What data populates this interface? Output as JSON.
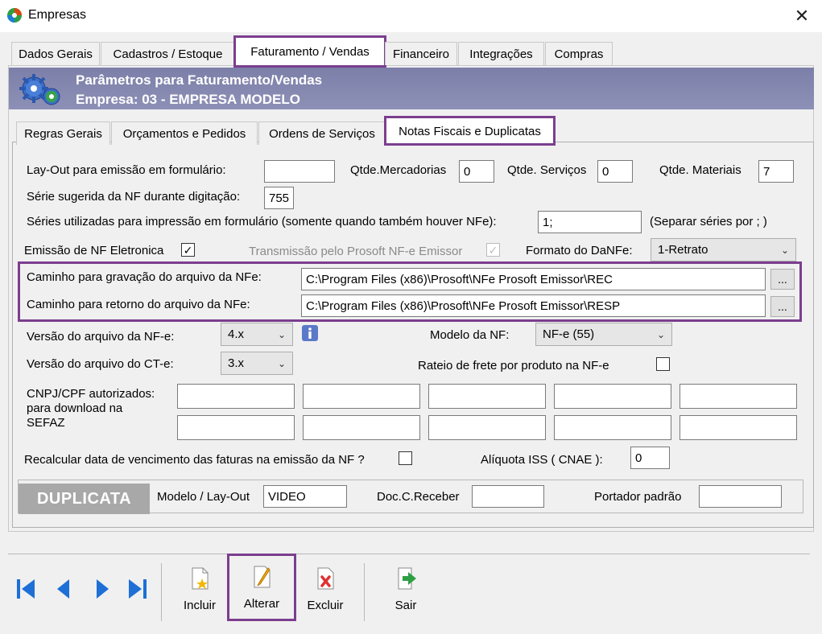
{
  "window": {
    "title": "Empresas"
  },
  "main_tabs": [
    "Dados Gerais",
    "Cadastros / Estoque",
    "Faturamento / Vendas",
    "Financeiro",
    "Integrações",
    "Compras"
  ],
  "banner": {
    "line1": "Parâmetros para Faturamento/Vendas",
    "line2": "Empresa: 03 - EMPRESA MODELO"
  },
  "sub_tabs": [
    "Regras Gerais",
    "Orçamentos e Pedidos",
    "Ordens de Serviços",
    "Notas Fiscais e Duplicatas"
  ],
  "form": {
    "layout_label": "Lay-Out para emissão em formulário:",
    "layout_value": "",
    "qtd_merc_label": "Qtde.Mercadorias",
    "qtd_merc_value": "0",
    "qtd_serv_label": "Qtde. Serviços",
    "qtd_serv_value": "0",
    "qtd_mat_label": "Qtde. Materiais",
    "qtd_mat_value": "7",
    "serie_label": "Série sugerida da NF durante digitação:",
    "serie_value": "755",
    "series_form_label": "Séries utilizadas para impressão em formulário (somente quando também houver NFe):",
    "series_form_value": "1;",
    "series_hint": "(Separar séries por ; )",
    "nfe_emissao_label": "Emissão de NF Eletronica",
    "nfe_emissao_checked": "✓",
    "transmissao_label": "Transmissão pelo Prosoft NF-e Emissor",
    "transmissao_checked": "✓",
    "danfe_label": "Formato do DaNFe:",
    "danfe_value": "1-Retrato",
    "path_grav_label": "Caminho para gravação do arquivo da NFe:",
    "path_grav_value": "C:\\Program Files (x86)\\Prosoft\\NFe Prosoft Emissor\\REC",
    "path_ret_label": "Caminho para retorno do arquivo da NFe:",
    "path_ret_value": "C:\\Program Files (x86)\\Prosoft\\NFe Prosoft Emissor\\RESP",
    "browse_label": "...",
    "versao_nfe_label": "Versão do arquivo da NF-e:",
    "versao_nfe_value": "4.x",
    "modelo_nf_label": "Modelo da NF:",
    "modelo_nf_value": "NF-e (55)",
    "versao_cte_label": "Versão do arquivo do CT-e:",
    "versao_cte_value": "3.x",
    "rateio_label": "Rateio de frete por produto na NF-e",
    "cnpj_label_1": "CNPJ/CPF autorizados:",
    "cnpj_label_2": "para download na",
    "cnpj_label_3": "SEFAZ",
    "recalc_label": "Recalcular data de vencimento das faturas na emissão da NF ?",
    "aliquota_label": "Alíquota ISS ( CNAE ):",
    "aliquota_value": "0"
  },
  "duplicata": {
    "title": "DUPLICATA",
    "modelo_label": "Modelo / Lay-Out",
    "modelo_value": "VIDEO",
    "doc_label": "Doc.C.Receber",
    "doc_value": "",
    "portador_label": "Portador padrão",
    "portador_value": ""
  },
  "toolbar": {
    "incluir": "Incluir",
    "alterar": "Alterar",
    "excluir": "Excluir",
    "sair": "Sair"
  },
  "colors": {
    "highlight": "#7b3e8e",
    "banner": "#8386ad",
    "nav_blue": "#1e6fd6"
  }
}
